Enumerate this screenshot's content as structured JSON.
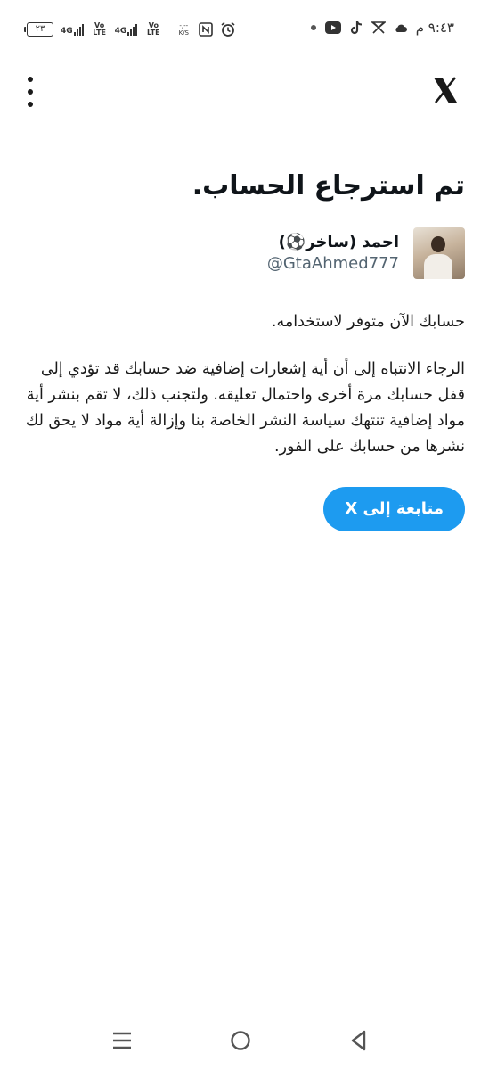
{
  "status_bar": {
    "time": "٩:٤٣ م",
    "battery": "٢٣",
    "network1": "4G",
    "volte1": "Vo LTE",
    "network2": "4G",
    "volte2": "Vo LTE",
    "speed_value": "-,--",
    "speed_unit": "K/S"
  },
  "topbar": {
    "close_icon": "x-logo-icon",
    "menu_icon": "more-vertical-icon"
  },
  "content": {
    "title": "تم استرجاع الحساب.",
    "profile": {
      "name": "احمد (ساخر⚽)",
      "handle": "@GtaAhmed777"
    },
    "paragraph1": "حسابك الآن متوفر لاستخدامه.",
    "paragraph2": "الرجاء الانتباه إلى أن أية إشعارات إضافية ضد حسابك قد تؤدي إلى قفل حسابك مرة أخرى واحتمال تعليقه. ولتجنب ذلك، لا تقم بنشر أية مواد إضافية تنتهك سياسة النشر الخاصة بنا وإزالة أية مواد لا يحق لك نشرها من حسابك على الفور.",
    "cta_label": "متابعة إلى X"
  },
  "colors": {
    "accent": "#1d9bf0",
    "text": "#0f1419",
    "muted": "#536471"
  }
}
